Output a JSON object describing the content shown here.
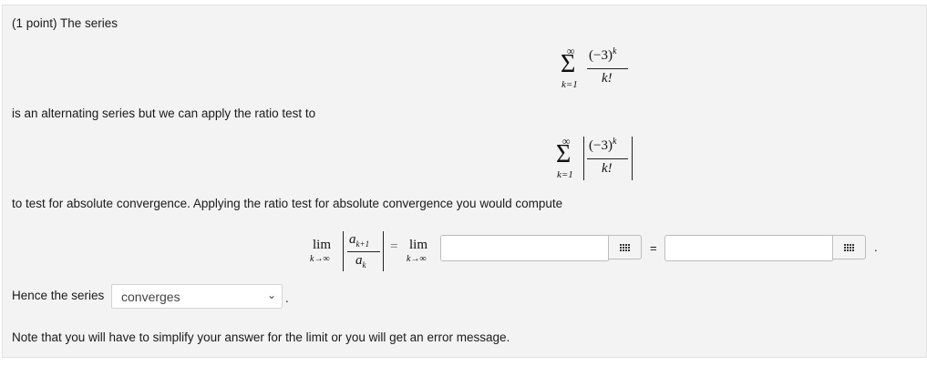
{
  "intro": {
    "points": "(1 point) The series"
  },
  "text_alternating": "is an alternating series but we can apply the ratio test to",
  "text_test": "to test for absolute convergence. Applying the ratio test for absolute convergence you would compute",
  "series1": {
    "sum_upper": "∞",
    "sum_lower": "k=1",
    "numerator": "(−3)",
    "exponent": "k",
    "denominator": "k!"
  },
  "series2": {
    "sum_upper": "∞",
    "sum_lower": "k=1",
    "numerator": "(−3)",
    "exponent": "k",
    "denominator": "k!"
  },
  "limit_expr": {
    "lim": "lim",
    "sub": "k→∞",
    "num": "a",
    "num_sub": "k+1",
    "den": "a",
    "den_sub": "k",
    "equals": "=",
    "lim2": "lim",
    "sub2": "k→∞"
  },
  "answer1": {
    "value": "",
    "placeholder": ""
  },
  "answer2": {
    "value": "",
    "placeholder": ""
  },
  "equals_sign": "=",
  "period": ".",
  "hence": {
    "label": "Hence the series",
    "selected": "converges",
    "trailing": "."
  },
  "note": "Note that you will have to simplify your answer for the limit or you will get an error message.",
  "icons": {
    "palette": "equation-palette-icon",
    "dropdown": "chevron-down-icon"
  }
}
